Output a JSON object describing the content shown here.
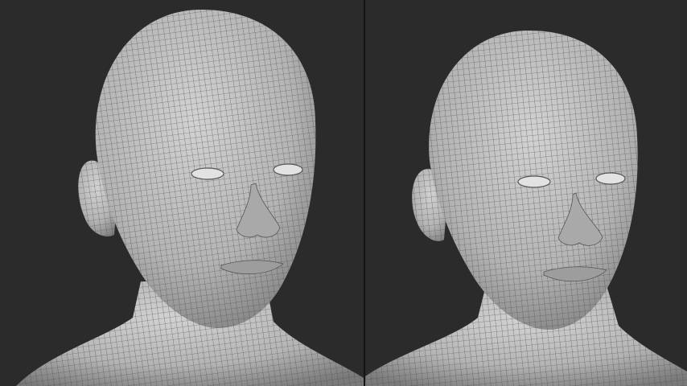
{
  "scene": {
    "background_color": "#2b2b2b",
    "mesh_color": "#b9b9b9",
    "wire_color": "#4a4a4a",
    "divider_color": "#141414",
    "panels": [
      {
        "id": "left",
        "subject": "head-wireframe-mesh"
      },
      {
        "id": "right",
        "subject": "head-wireframe-mesh"
      }
    ]
  }
}
